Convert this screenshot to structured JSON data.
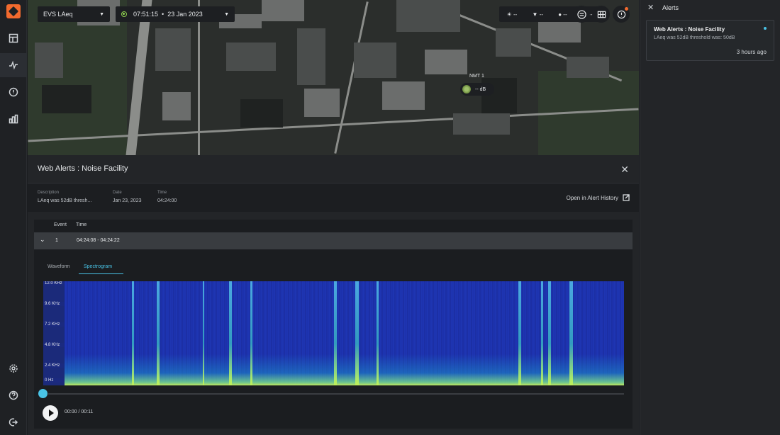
{
  "map": {
    "device_select": "EVS LAeq",
    "time_display": "07:51:15",
    "date_display": "23  Jan  2023",
    "weather": [
      {
        "icon": "sun-icon",
        "value": "--"
      },
      {
        "icon": "wind-icon",
        "value": "--"
      },
      {
        "icon": "rain-drop-icon",
        "value": "--"
      },
      {
        "icon": "weather-circle-icon",
        "value": "--"
      }
    ],
    "zoom_in": "+",
    "zoom_out": "−",
    "station_label": "NMT 1",
    "station_value": "-- dB"
  },
  "panel": {
    "title": "Web Alerts : Noise Facility",
    "description_label": "Description",
    "description_value": "LAeq was 52dB thresh...",
    "date_label": "Date",
    "date_value": "Jan 23, 2023",
    "time_label": "Time",
    "time_value": "04:24:00",
    "open_history": "Open in Alert History",
    "event_col": "Event",
    "time_col": "Time",
    "event_number": "1",
    "event_range": "04:24:08 - 04:24:22",
    "tab_waveform": "Waveform",
    "tab_spectrogram": "Spectrogram",
    "y_ticks": [
      "12.0 KHz",
      "9.6 KHz",
      "7.2 KHz",
      "4.8 KHz",
      "2.4 KHz",
      "0 Hz"
    ],
    "playback_time": "00:00 / 00:11",
    "playback_progress": 0
  },
  "sidebar": {
    "title": "Alerts",
    "alert": {
      "title": "Web Alerts : Noise Facility",
      "subtitle": "LAeq was 52dB threshold was: 50dB",
      "ago": "3 hours ago"
    }
  },
  "colors": {
    "accent": "#49c3e6",
    "brand": "#f26a2e",
    "status_online": "#8fd14f"
  }
}
